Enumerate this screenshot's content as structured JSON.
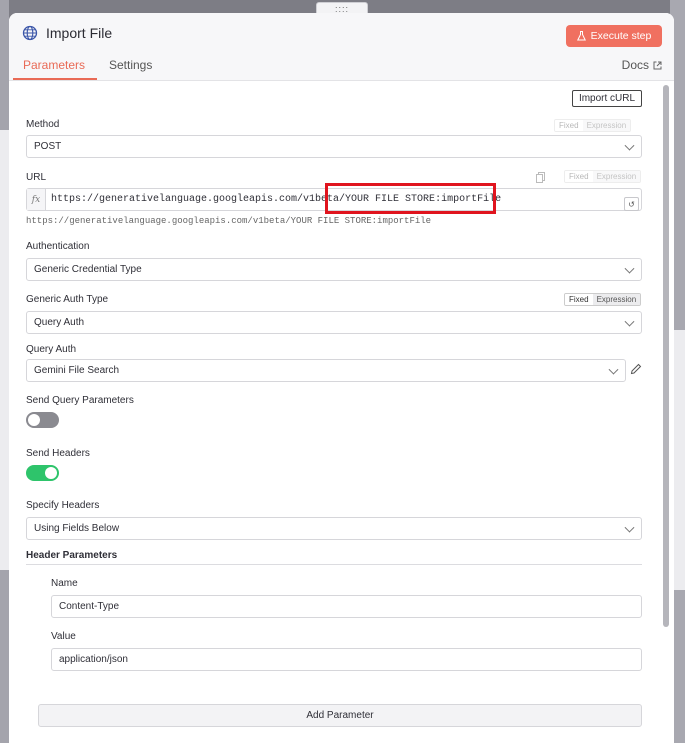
{
  "drag_handle": "::::",
  "header": {
    "title": "Import File",
    "execute_label": "Execute step",
    "tabs": [
      "Parameters",
      "Settings"
    ],
    "docs_label": "Docs"
  },
  "import_curl_label": "Import cURL",
  "method": {
    "label": "Method",
    "value": "POST"
  },
  "url": {
    "label": "URL",
    "value": "https://generativelanguage.googleapis.com/v1beta/YOUR FILE STORE:importFile",
    "resolved": "https://generativelanguage.googleapis.com/v1beta/YOUR FILE STORE:importFile",
    "fx": "fx",
    "undo": "↺"
  },
  "fixed_label": "Fixed",
  "expression_label": "Expression",
  "authentication": {
    "label": "Authentication",
    "value": "Generic Credential Type"
  },
  "generic_auth_type": {
    "label": "Generic Auth Type",
    "value": "Query Auth"
  },
  "query_auth": {
    "label": "Query Auth",
    "value": "Gemini File Search"
  },
  "send_query_params": {
    "label": "Send Query Parameters",
    "enabled": false
  },
  "send_headers": {
    "label": "Send Headers",
    "enabled": true
  },
  "specify_headers": {
    "label": "Specify Headers",
    "value": "Using Fields Below"
  },
  "header_parameters": {
    "title": "Header Parameters",
    "name_label": "Name",
    "name_value": "Content-Type",
    "value_label": "Value",
    "value_value": "application/json"
  },
  "add_parameter_label": "Add Parameter",
  "colors": {
    "accent": "#f07060",
    "toggle_on": "#2ec46b",
    "highlight": "#e0141e"
  }
}
